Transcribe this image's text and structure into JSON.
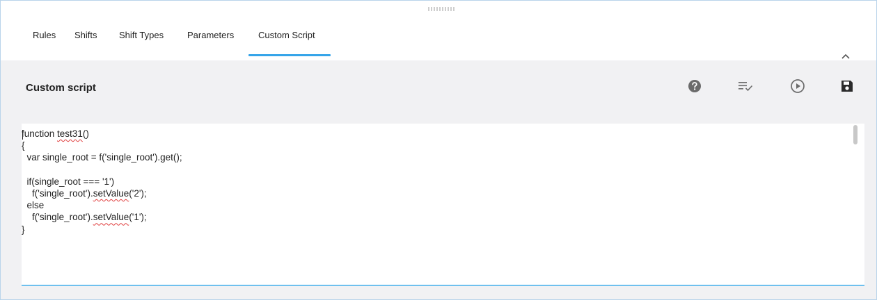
{
  "tabs": [
    {
      "label": "Rules"
    },
    {
      "label": "Shifts"
    },
    {
      "label": "Shift Types"
    },
    {
      "label": "Parameters"
    },
    {
      "label": "Custom Script",
      "active": true
    }
  ],
  "header": {
    "title": "Custom script"
  },
  "toolbar": {
    "icons": [
      "help-icon",
      "format-list-check-icon",
      "play-icon",
      "save-icon"
    ]
  },
  "editor": {
    "lines": [
      "function test31()",
      "{",
      "  var single_root = f('single_root').get();",
      "",
      "  if(single_root === '1')",
      "    f('single_root').setValue('2');",
      "  else",
      "    f('single_root').setValue('1');",
      "}"
    ]
  },
  "colors": {
    "accent": "#35a4e9",
    "panel_background": "#f1f1f3",
    "icon_gray": "#6b6b6b",
    "save_icon": "#2b2b2b"
  }
}
